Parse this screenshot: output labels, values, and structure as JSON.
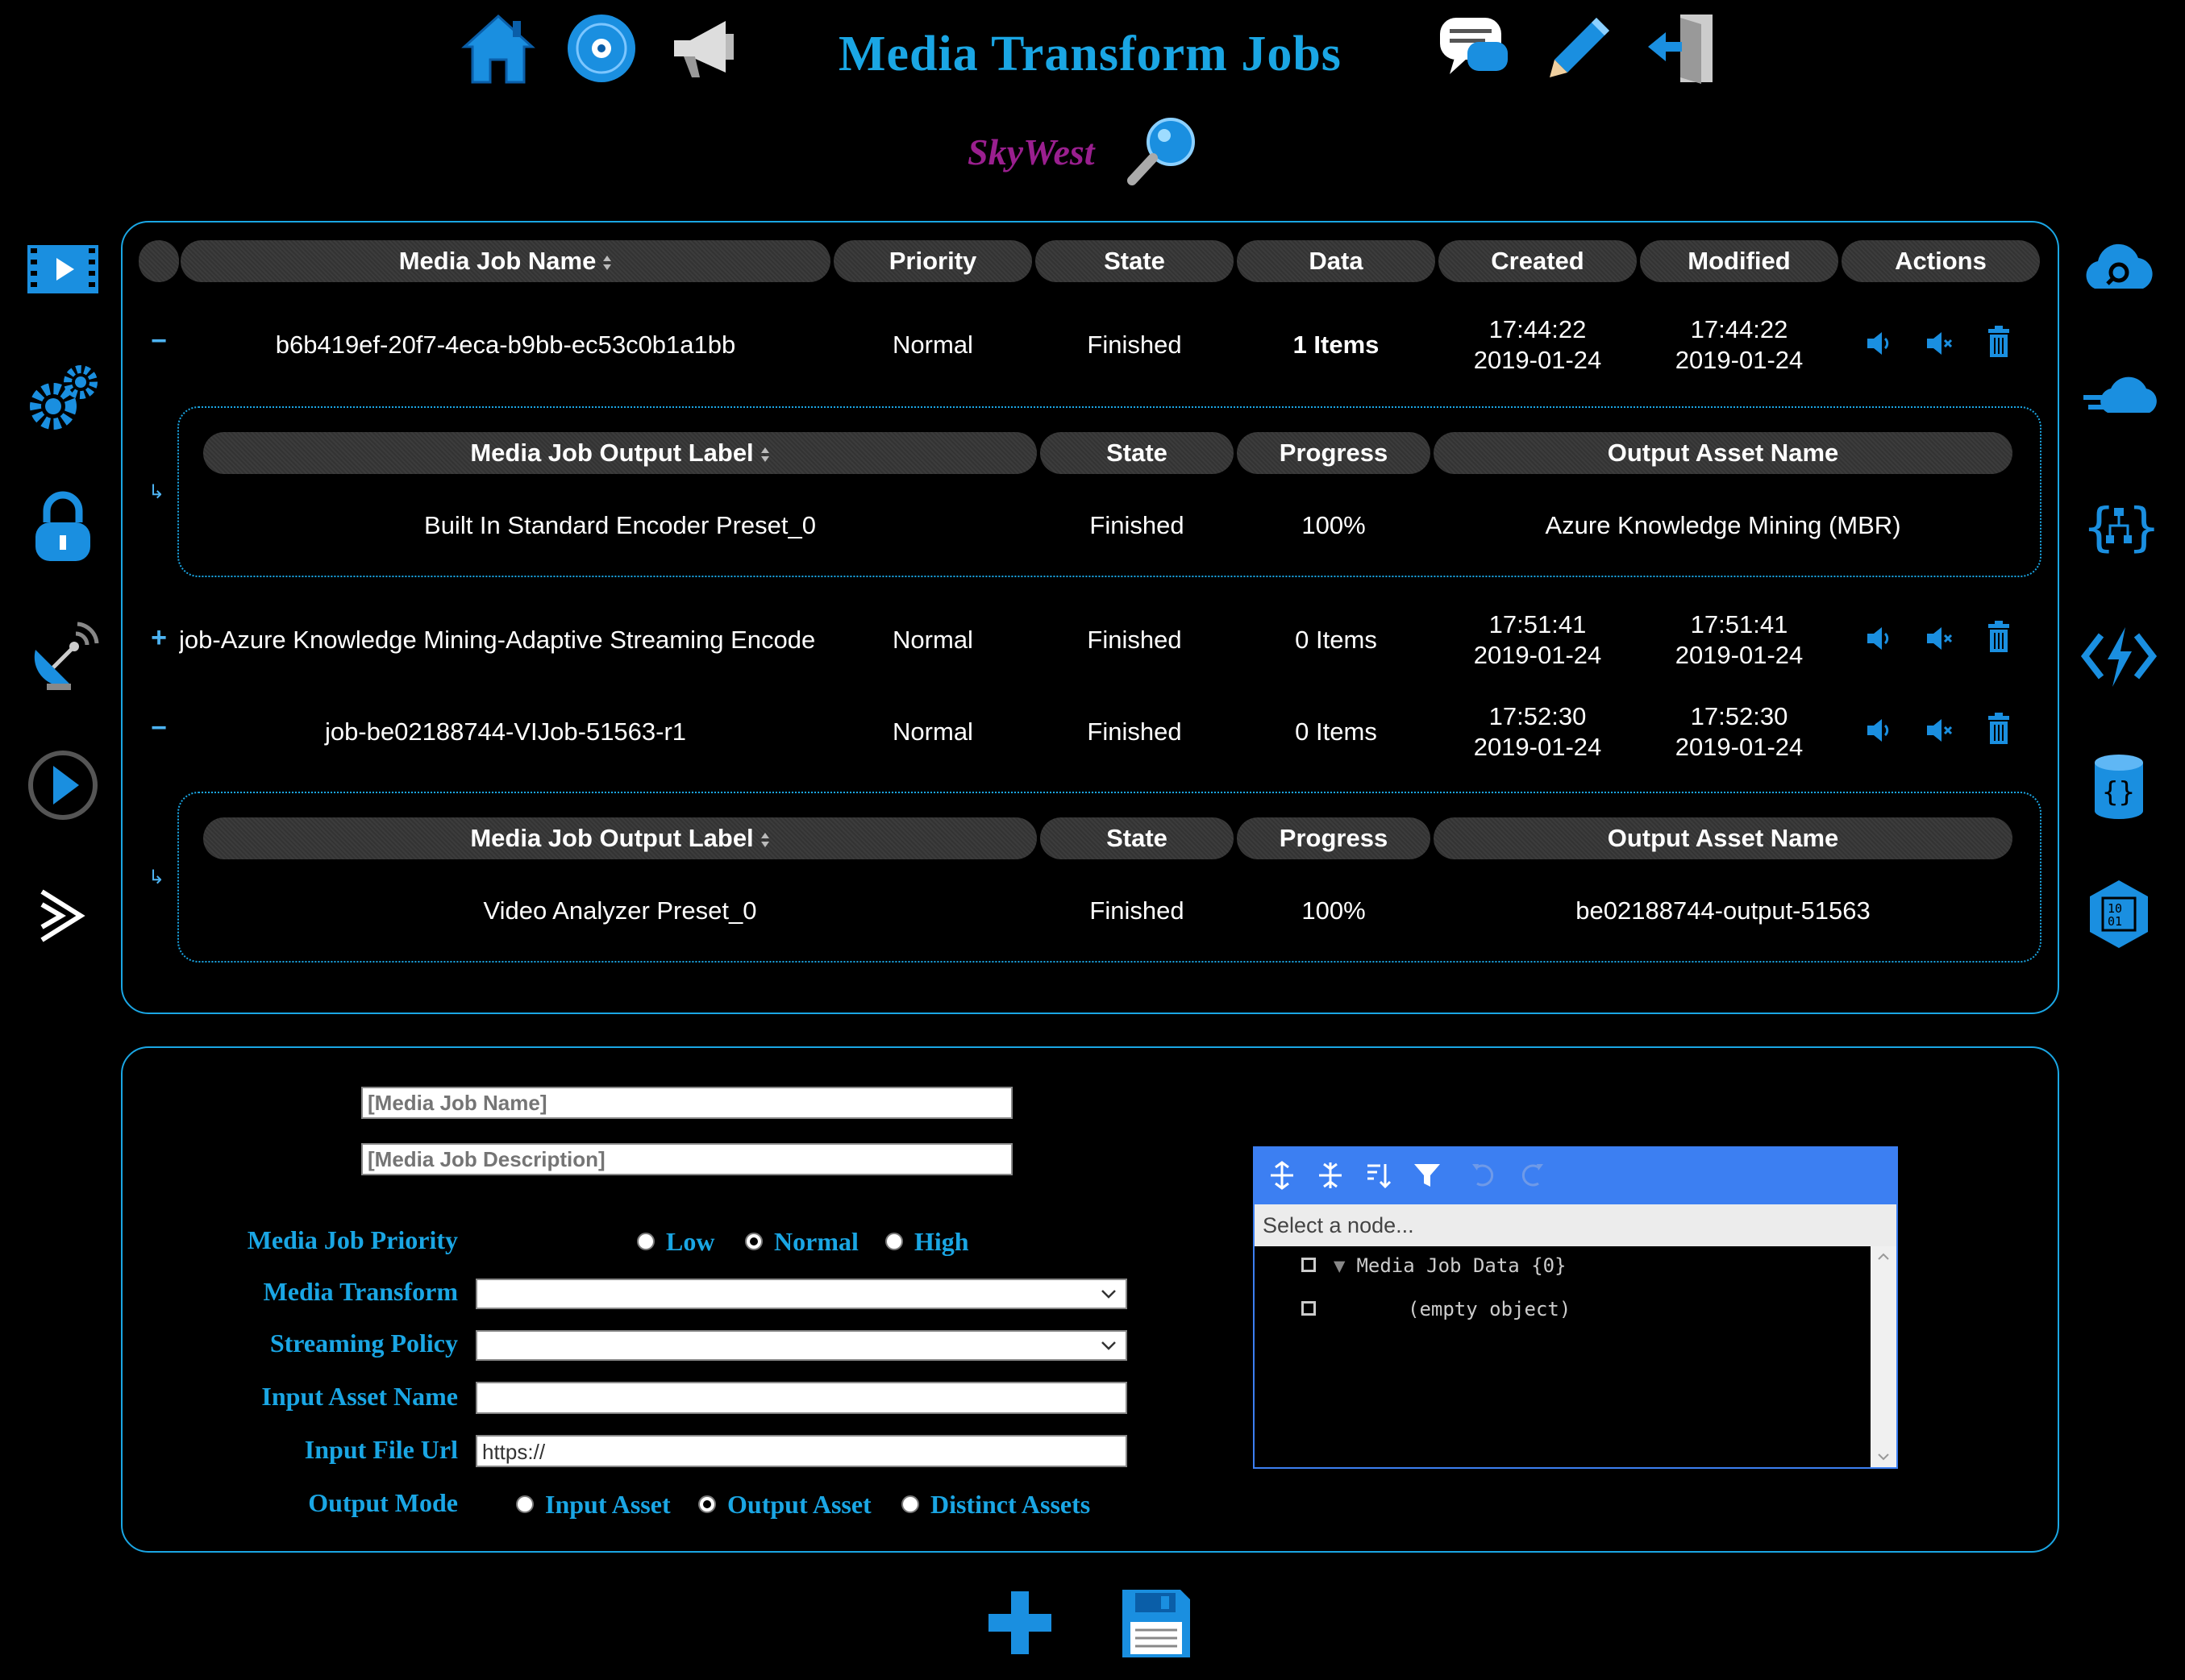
{
  "header": {
    "title": "Media Transform Jobs",
    "brand": "SkyWest",
    "left_icons": [
      "home-icon",
      "disc-icon",
      "megaphone-icon"
    ],
    "right_icons": [
      "chat-icon",
      "pencil-icon",
      "sign-out-icon"
    ]
  },
  "left_sidebar": [
    "video-icon",
    "gears-icon",
    "lock-icon",
    "satellite-dish-icon",
    "play-circle-icon",
    "stream-icon"
  ],
  "right_sidebar": [
    "cloud-search-icon",
    "fast-cloud-icon",
    "api-hierarchy-icon",
    "function-bolt-icon",
    "database-json-icon",
    "binary-hex-icon"
  ],
  "jobs_table": {
    "columns": [
      "Media Job Name",
      "Priority",
      "State",
      "Data",
      "Created",
      "Modified",
      "Actions"
    ],
    "rows": [
      {
        "toggle": "−",
        "name": "b6b419ef-20f7-4eca-b9bb-ec53c0b1a1bb",
        "priority": "Normal",
        "state": "Finished",
        "data": "1 Items",
        "created_time": "17:44:22",
        "created_date": "2019-01-24",
        "modified_time": "17:44:22",
        "modified_date": "2019-01-24"
      },
      {
        "toggle": "+",
        "name": "job-Azure Knowledge Mining-Adaptive Streaming Encode",
        "priority": "Normal",
        "state": "Finished",
        "data": "0 Items",
        "created_time": "17:51:41",
        "created_date": "2019-01-24",
        "modified_time": "17:51:41",
        "modified_date": "2019-01-24"
      },
      {
        "toggle": "−",
        "name": "job-be02188744-VIJob-51563-r1",
        "priority": "Normal",
        "state": "Finished",
        "data": "0 Items",
        "created_time": "17:52:30",
        "created_date": "2019-01-24",
        "modified_time": "17:52:30",
        "modified_date": "2019-01-24"
      }
    ],
    "detail_arrow": "↳",
    "outputs": {
      "columns": [
        "Media Job Output Label",
        "State",
        "Progress",
        "Output Asset Name"
      ],
      "rows": [
        {
          "label": "Built In Standard Encoder Preset_0",
          "state": "Finished",
          "progress": "100%",
          "asset": "Azure Knowledge Mining (MBR)"
        },
        {
          "label": "Video Analyzer Preset_0",
          "state": "Finished",
          "progress": "100%",
          "asset": "be02188744-output-51563"
        }
      ]
    }
  },
  "form": {
    "job_name_placeholder": "[Media Job Name]",
    "job_description_placeholder": "[Media Job Description]",
    "priority_label": "Media Job Priority",
    "priority_options": [
      "Low",
      "Normal",
      "High"
    ],
    "priority_selected": "Normal",
    "transform_label": "Media Transform",
    "streaming_policy_label": "Streaming Policy",
    "input_asset_label": "Input Asset Name",
    "input_url_label": "Input File Url",
    "input_url_value": "https://",
    "output_mode_label": "Output Mode",
    "output_mode_options": [
      "Input Asset",
      "Output Asset",
      "Distinct Assets"
    ],
    "output_mode_selected": "Output Asset"
  },
  "json_editor": {
    "search_placeholder": "Select a node...",
    "root_text": "Media Job Data {0}",
    "empty_text": "(empty object)",
    "toolbar_icons": [
      "expand-all-icon",
      "collapse-all-icon",
      "sort-icon",
      "filter-icon",
      "undo-icon",
      "redo-icon"
    ]
  },
  "bottom_actions": [
    "add-icon",
    "save-icon"
  ],
  "colors": {
    "accent": "#1aa6e4",
    "brand": "#9a1f8f",
    "editor_bar": "#3c7ff2",
    "background": "#000000"
  }
}
